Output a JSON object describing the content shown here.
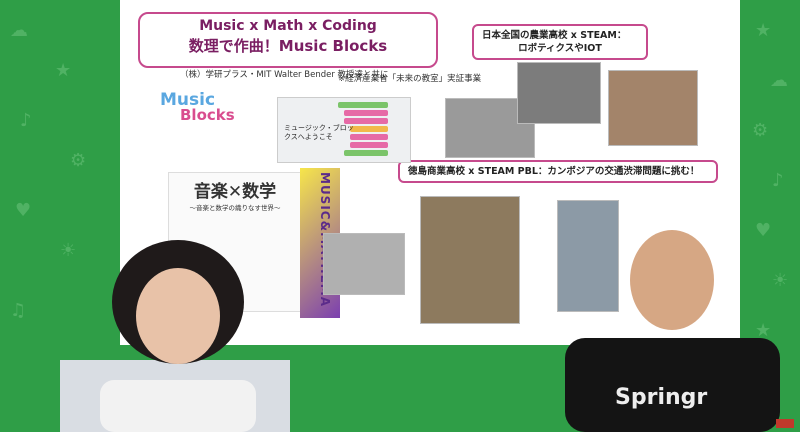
{
  "slide": {
    "title_line1": "Music x Math x Coding",
    "title_line2": "数理で作曲！Music Blocks",
    "subtitle": "（株）学研プラス・MIT Walter Bender 教授達と共に",
    "note": "※経済産業省「未来の教室」実証事業",
    "callout1_line1": "日本全国の農業高校 x STEAM：",
    "callout1_line2": "ロボティクスやIOT",
    "callout2": "徳島商業高校 x STEAM PBL：カンボジアの交通渋滞問題に挑む！",
    "logo_word1": "Music",
    "logo_word2": "Blocks",
    "mb_text_line1": "ミュージック・ブロッ",
    "mb_text_line2": "クスへようこそ",
    "poster_title": "音楽✕数学",
    "poster_subtitle": "〜音楽と数学の織りなす世界〜",
    "book_title": "MUSIC&MATHEMA"
  },
  "video": {
    "shirt_text": "Springr"
  },
  "colors": {
    "background": "#2f9e47",
    "accent": "#c64a8d"
  }
}
